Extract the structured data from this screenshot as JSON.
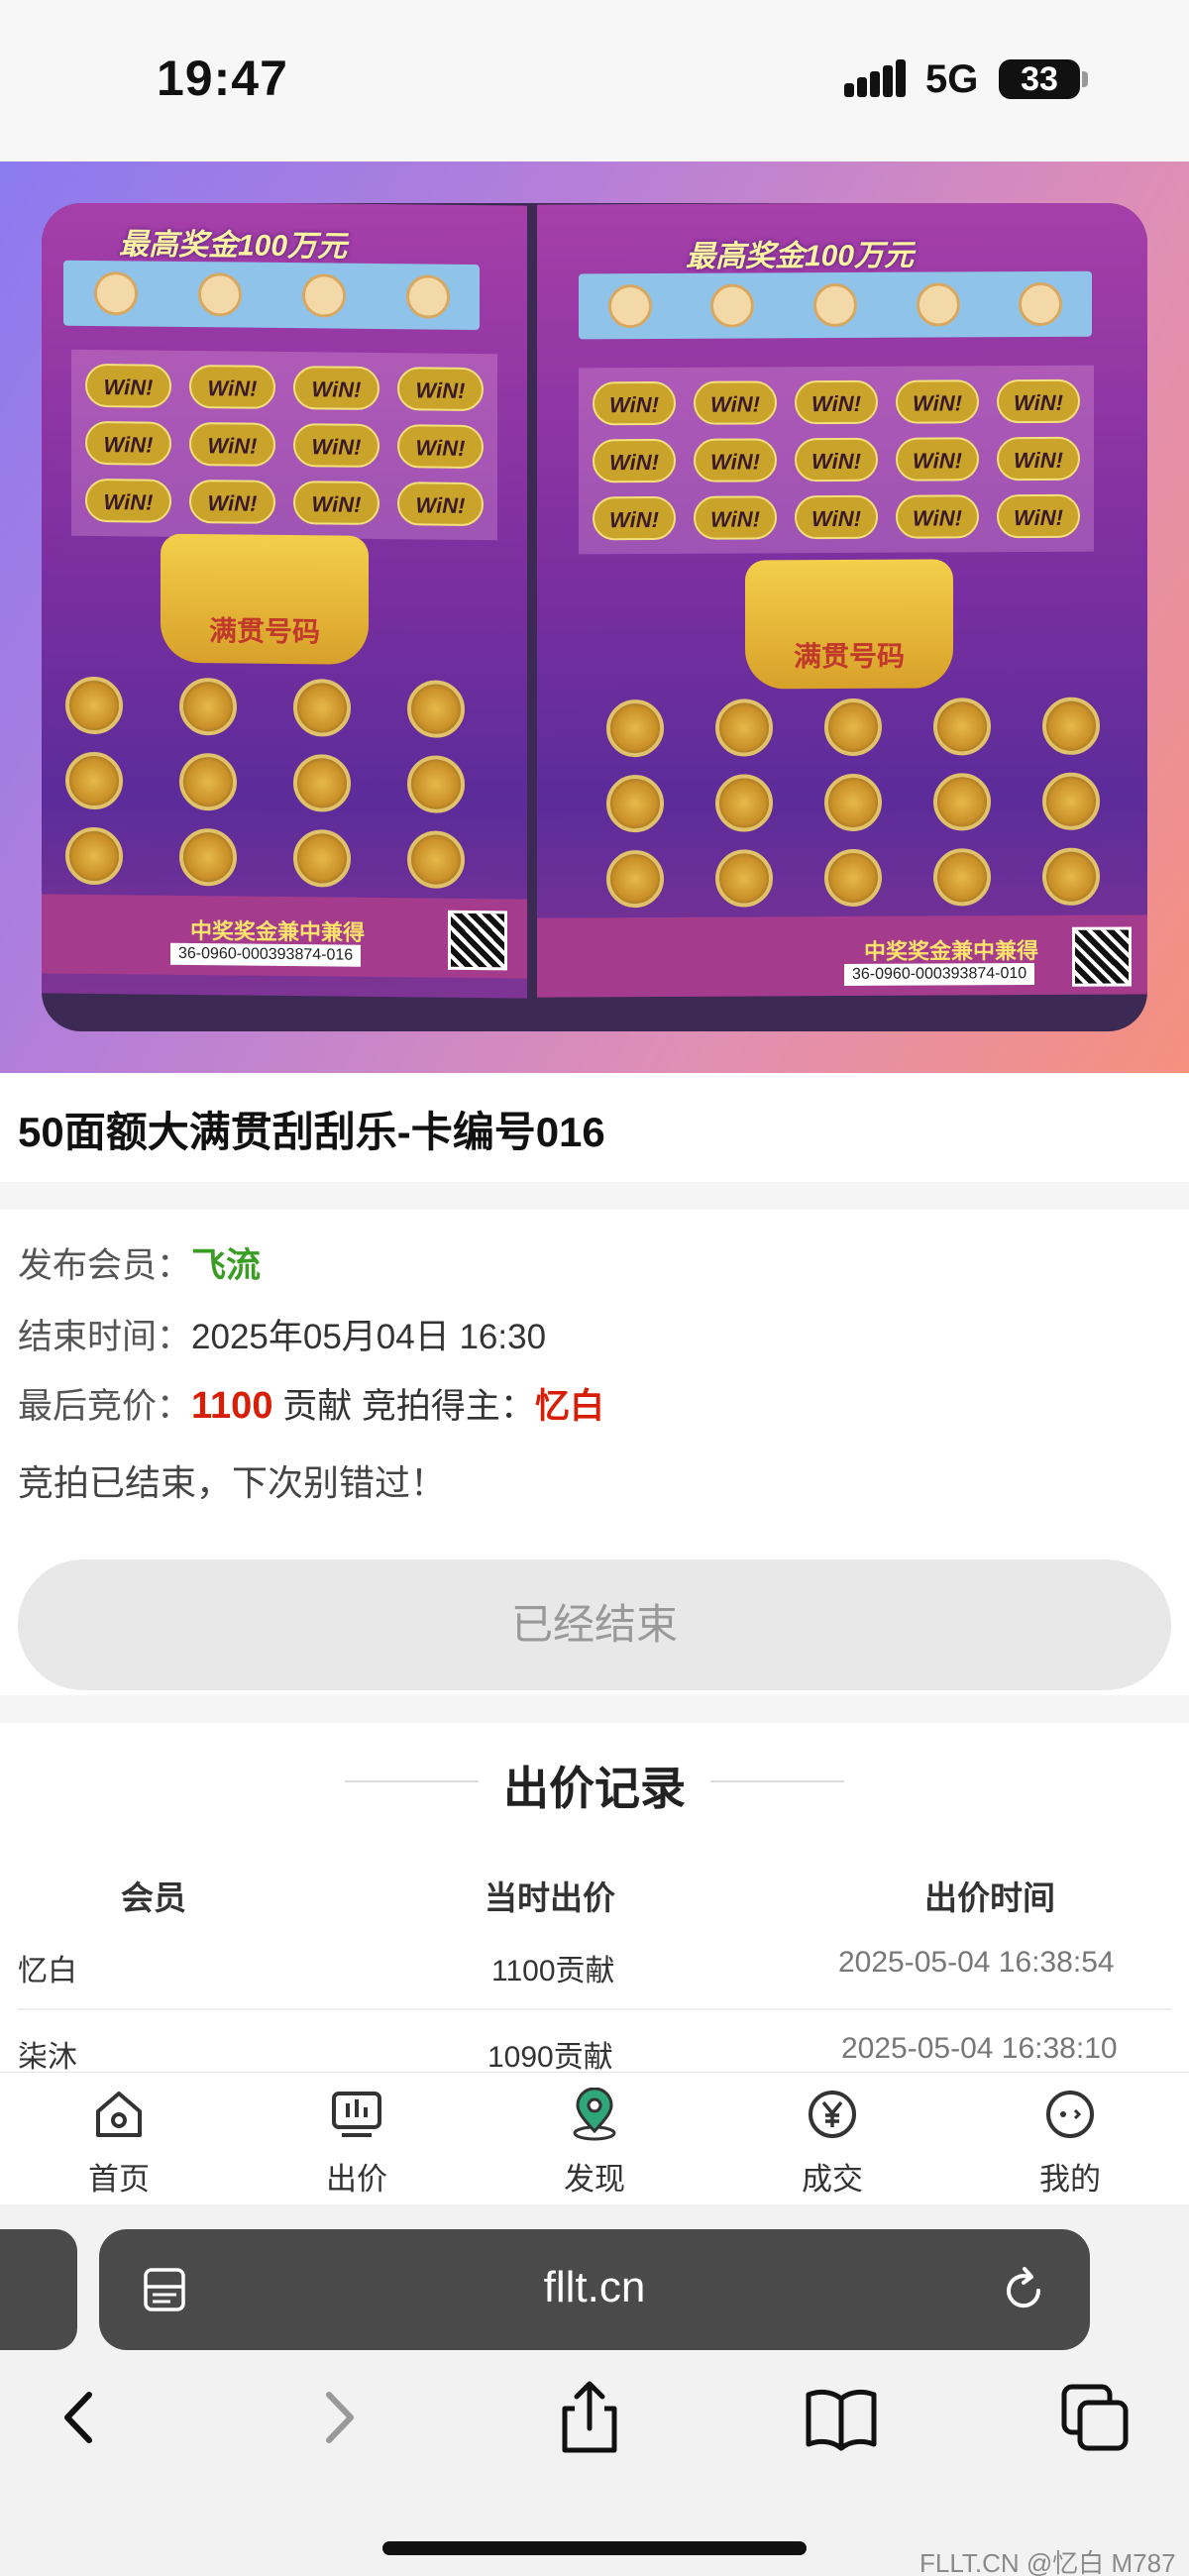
{
  "status_bar": {
    "time": "19:47",
    "network": "5G",
    "battery": "33"
  },
  "hero": {
    "left_card": {
      "header": "最高奖金100万元",
      "win_text": "WiN!",
      "trophy_label": "满贯号码",
      "prize_text": "中奖奖金兼中兼得",
      "serial": "36-0960-000393874-016"
    },
    "right_card": {
      "header": "最高奖金100万元",
      "win_text": "WiN!",
      "trophy_label": "满贯号码",
      "prize_text": "中奖奖金兼中兼得",
      "serial": "36-0960-000393874-010"
    }
  },
  "item": {
    "title": "50面额大满贯刮刮乐-卡编号016"
  },
  "info": {
    "publisher_label": "发布会员：",
    "publisher_value": "飞流",
    "end_time_label": "结束时间：",
    "end_time_value": "2025年05月04日 16:30",
    "last_bid_label": "最后竞价：",
    "last_bid_value": "1100",
    "last_bid_unit": " 贡献 ",
    "winner_label": "竞拍得主：",
    "winner_value": "忆白",
    "notice": "竞拍已结束，下次别错过！",
    "ended_button": "已经结束"
  },
  "bid_record": {
    "heading": "出价记录",
    "columns": [
      "会员",
      "当时出价",
      "出价时间"
    ],
    "rows": [
      {
        "member": "忆白",
        "bid": "1100贡献",
        "time": "2025-05-04 16:38:54"
      },
      {
        "member": "柒沐",
        "bid": "1090贡献",
        "time": "2025-05-04 16:38:10"
      }
    ]
  },
  "tab_bar": {
    "items": [
      {
        "label": "首页",
        "icon": "home-icon"
      },
      {
        "label": "出价",
        "icon": "bid-chart-icon"
      },
      {
        "label": "发现",
        "icon": "location-pin-icon"
      },
      {
        "label": "成交",
        "icon": "yuan-deal-icon"
      },
      {
        "label": "我的",
        "icon": "profile-face-icon"
      }
    ]
  },
  "browser": {
    "url": "fllt.cn"
  },
  "watermark": "FLLT.CN @忆白 M787",
  "colors": {
    "accent_green": "#3a9d23",
    "accent_red": "#d81e06",
    "disabled_button": "#e8e8e8",
    "url_bar": "#4a4a4a"
  }
}
